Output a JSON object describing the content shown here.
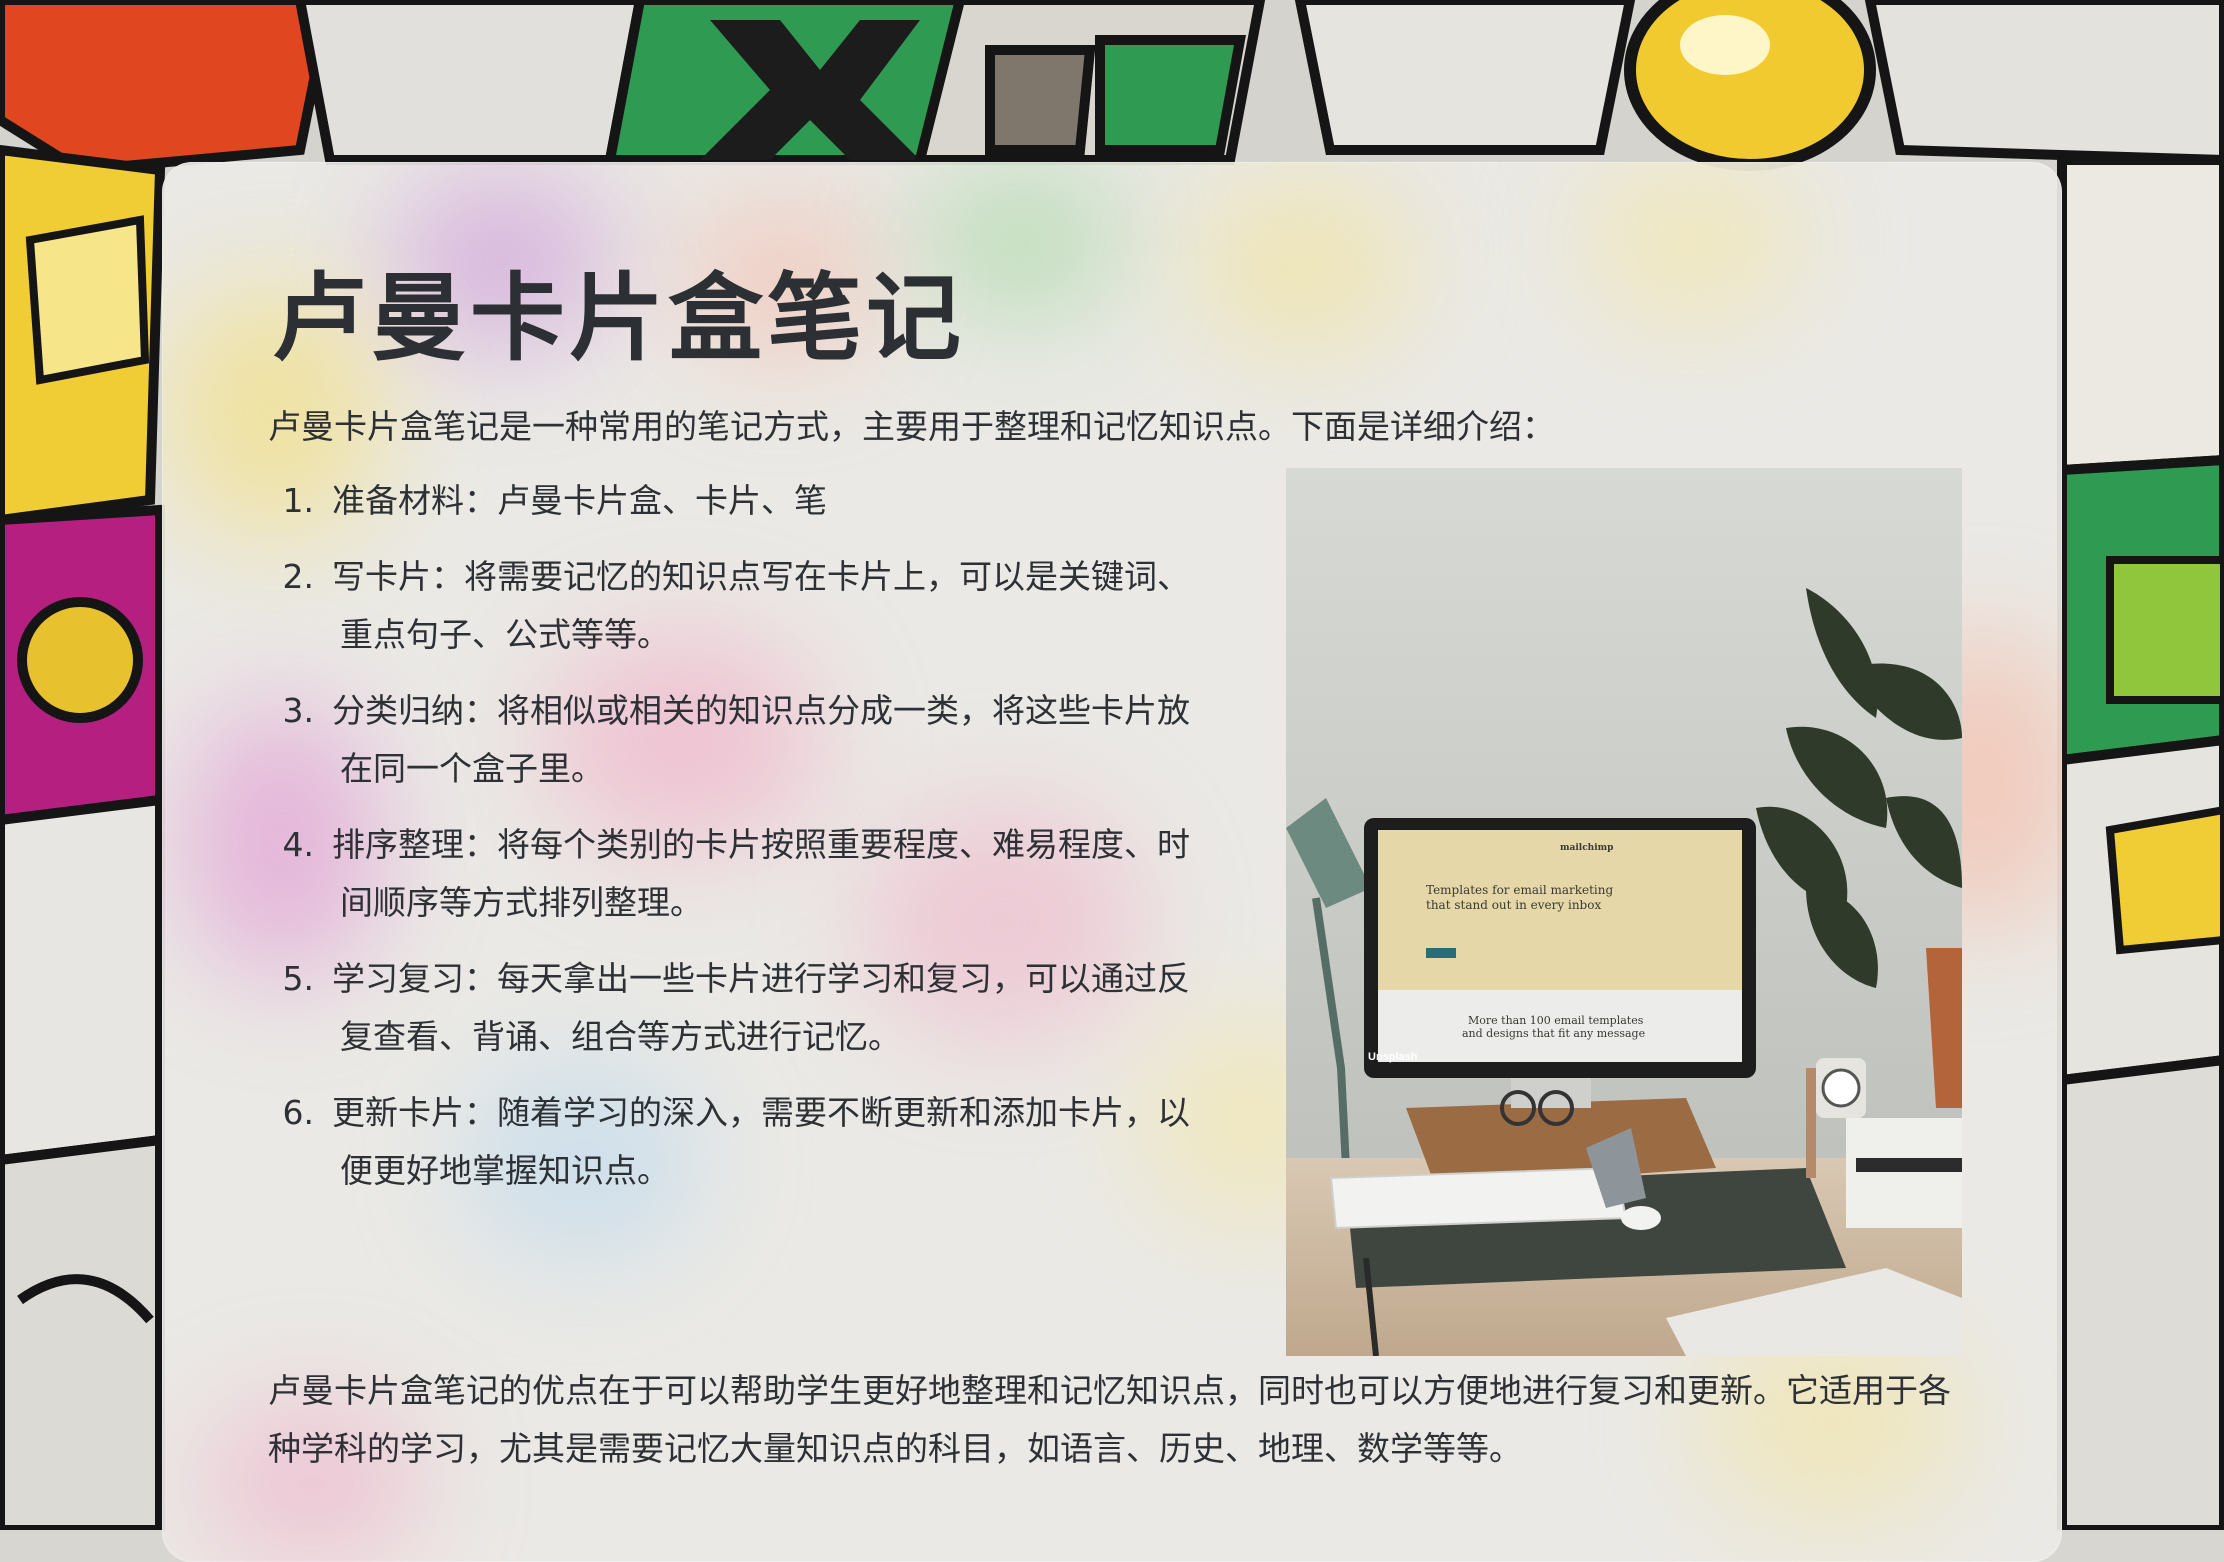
{
  "title": "卢曼卡片盒笔记",
  "intro": "卢曼卡片盒笔记是一种常用的笔记方式，主要用于整理和记忆知识点。下面是详细介绍：",
  "steps": [
    {
      "num": "1.",
      "text": "准备材料：卢曼卡片盒、卡片、笔"
    },
    {
      "num": "2.",
      "text": "写卡片：将需要记忆的知识点写在卡片上，可以是关键词、重点句子、公式等等。"
    },
    {
      "num": "3.",
      "text": "分类归纳：将相似或相关的知识点分成一类，将这些卡片放在同一个盒子里。"
    },
    {
      "num": "4.",
      "text": "排序整理：将每个类别的卡片按照重要程度、难易程度、时间顺序等方式排列整理。"
    },
    {
      "num": "5.",
      "text": "学习复习：每天拿出一些卡片进行学习和复习，可以通过反复查看、背诵、组合等方式进行记忆。"
    },
    {
      "num": "6.",
      "text": "更新卡片：随着学习的深入，需要不断更新和添加卡片，以便更好地掌握知识点。"
    }
  ],
  "conclusion": "卢曼卡片盒笔记的优点在于可以帮助学生更好地整理和记忆知识点，同时也可以方便地进行复习和更新。它适用于各种学科的学习，尤其是需要记忆大量知识点的科目，如语言、历史、地理、数学等等。",
  "photo": {
    "screen_headline_1": "Templates for email marketing",
    "screen_headline_2": "that stand out in every inbox",
    "screen_sub_1": "More than 100 email templates",
    "screen_sub_2": "and designs that fit any message",
    "screen_brand": "mailchimp",
    "watermark": "Unsplash"
  },
  "colors": {
    "card_text": "#2d3135",
    "card_bg": "#ecebe6"
  }
}
